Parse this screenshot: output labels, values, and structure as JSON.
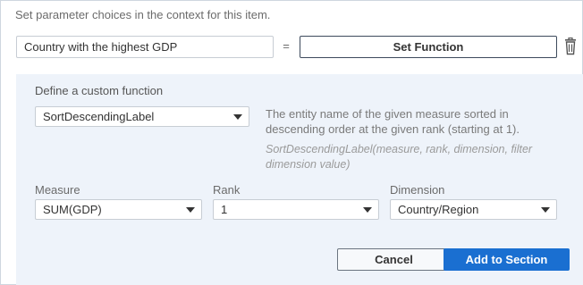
{
  "header": {
    "instruction": "Set parameter choices in the context for this item."
  },
  "parameter": {
    "name_value": "Country with the highest GDP",
    "equals": "=",
    "set_function_label": "Set Function"
  },
  "panel": {
    "title": "Define a custom function",
    "function_select": {
      "selected": "SortDescendingLabel"
    },
    "description": "The entity name of the given measure sorted in descending order at the given rank (starting at 1).",
    "signature": "SortDescendingLabel(measure, rank, dimension, filter dimension value)",
    "fields": {
      "measure": {
        "label": "Measure",
        "selected": "SUM(GDP)"
      },
      "rank": {
        "label": "Rank",
        "selected": "1"
      },
      "dimension": {
        "label": "Dimension",
        "selected": "Country/Region"
      }
    },
    "cancel_label": "Cancel",
    "add_label": "Add to Section"
  },
  "icons": {
    "delete": "trash-icon",
    "dropdown": "chevron-down-icon"
  },
  "colors": {
    "primary": "#1a6fd1",
    "panel_bg": "#eef3fa",
    "border": "#c7cdd4"
  }
}
